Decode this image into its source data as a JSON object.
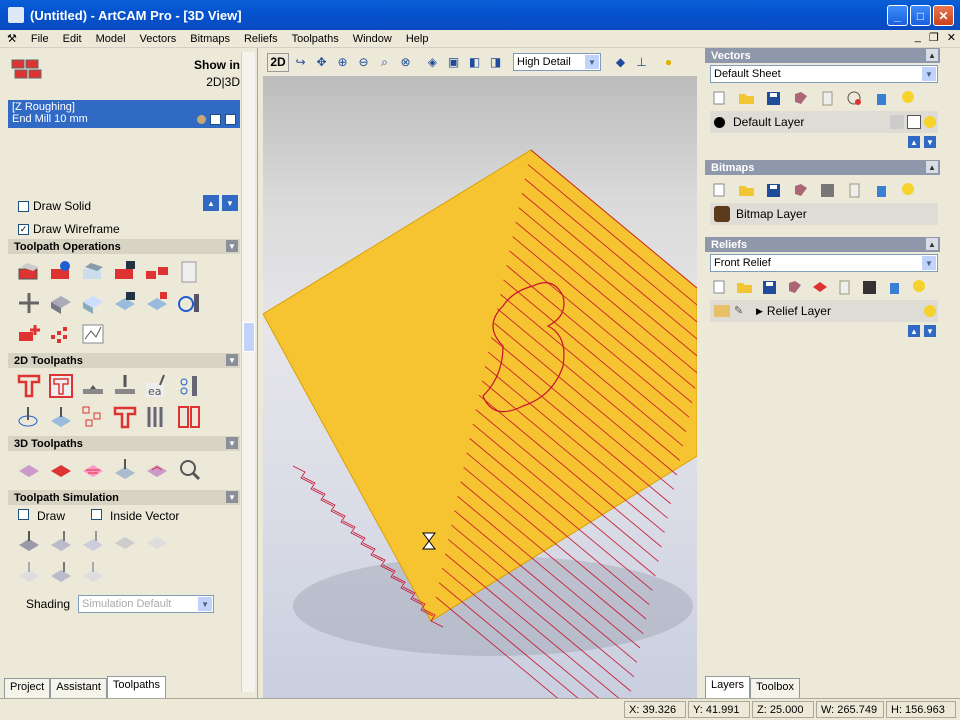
{
  "title": "(Untitled) - ArtCAM Pro - [3D View]",
  "menu": [
    "File",
    "Edit",
    "Model",
    "Vectors",
    "Bitmaps",
    "Reliefs",
    "Toolpaths",
    "Window",
    "Help"
  ],
  "left": {
    "show_in": "Show in",
    "show_modes": "2D|3D",
    "toolpath_name": "[Z Roughing]",
    "toolpath_tool": "End Mill 10 mm",
    "draw_solid": "Draw Solid",
    "draw_wireframe": "Draw Wireframe",
    "sections": {
      "ops": "Toolpath Operations",
      "tp2d": "2D Toolpaths",
      "tp3d": "3D Toolpaths",
      "sim": "Toolpath Simulation"
    },
    "sim_draw": "Draw",
    "sim_inside": "Inside Vector",
    "shading_label": "Shading",
    "shading_value": "Simulation Default",
    "tabs": [
      "Project",
      "Assistant",
      "Toolpaths"
    ]
  },
  "view": {
    "mode_2d": "2D",
    "detail": "High Detail"
  },
  "right": {
    "vectors": {
      "title": "Vectors",
      "sheet": "Default Sheet",
      "layer": "Default Layer"
    },
    "bitmaps": {
      "title": "Bitmaps",
      "layer": "Bitmap Layer"
    },
    "reliefs": {
      "title": "Reliefs",
      "select": "Front Relief",
      "layer": "Relief Layer"
    },
    "tabs": [
      "Layers",
      "Toolbox"
    ]
  },
  "status": {
    "x": "X: 39.326",
    "y": "Y: 41.991",
    "z": "Z: 25.000",
    "w": "W: 265.749",
    "h": "H: 156.963"
  },
  "colors": {
    "accent": "#316ac5",
    "slab": "#f7c431",
    "path": "#c8102e"
  }
}
